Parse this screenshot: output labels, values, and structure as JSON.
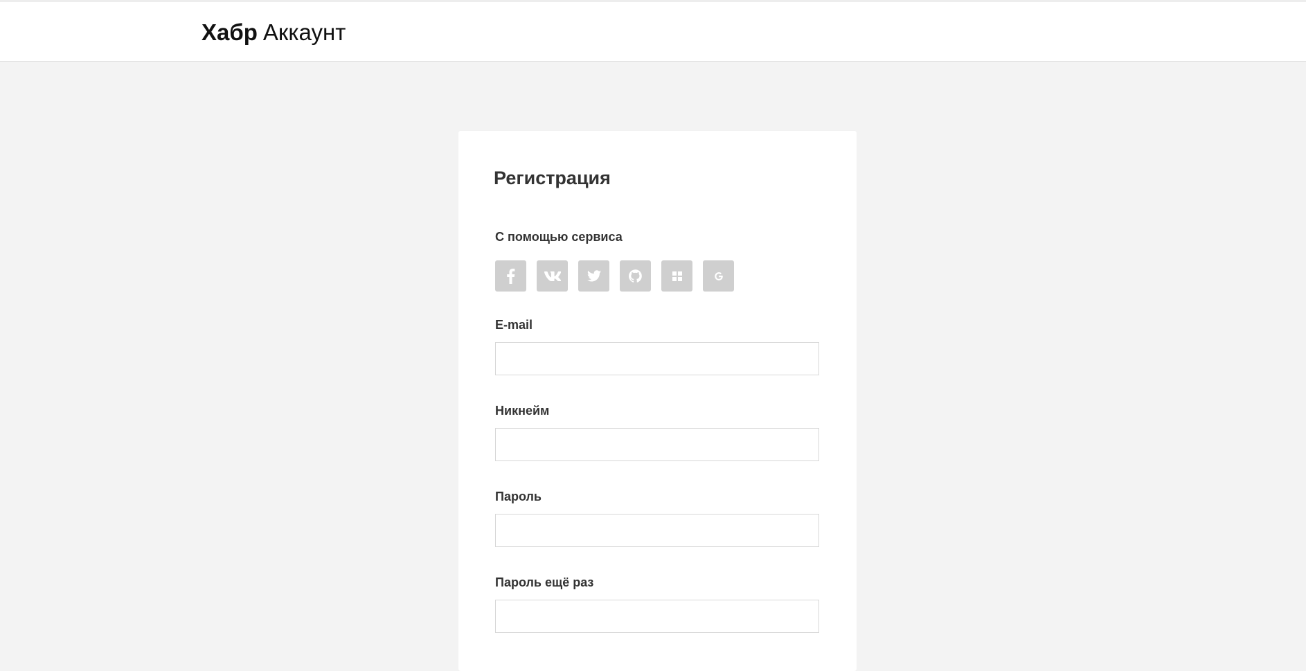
{
  "header": {
    "brand": "Хабр",
    "product": "Аккаунт"
  },
  "form": {
    "title": "Регистрация",
    "social_label": "С помощью сервиса",
    "social_services": [
      {
        "name": "facebook",
        "icon": "facebook-icon"
      },
      {
        "name": "vk",
        "icon": "vk-icon"
      },
      {
        "name": "twitter",
        "icon": "twitter-icon"
      },
      {
        "name": "github",
        "icon": "github-icon"
      },
      {
        "name": "live",
        "icon": "windows-icon"
      },
      {
        "name": "google",
        "icon": "google-icon"
      }
    ],
    "fields": {
      "email": {
        "label": "E-mail",
        "value": "",
        "placeholder": ""
      },
      "nickname": {
        "label": "Никнейм",
        "value": "",
        "placeholder": ""
      },
      "password": {
        "label": "Пароль",
        "value": "",
        "placeholder": ""
      },
      "password_repeat": {
        "label": "Пароль ещё раз",
        "value": "",
        "placeholder": ""
      }
    }
  },
  "colors": {
    "page_background": "#f3f3f3",
    "card_background": "#ffffff",
    "social_button": "#cfcfcf",
    "text": "#333333",
    "input_border": "#d7d7d7"
  }
}
